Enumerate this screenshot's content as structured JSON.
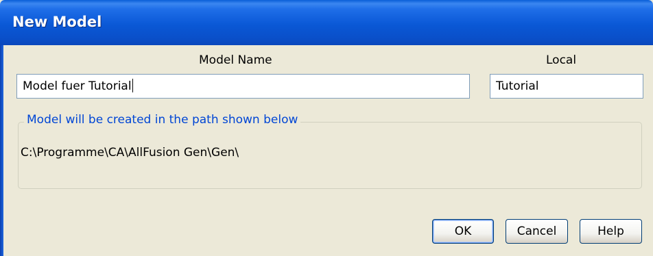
{
  "window": {
    "title": "New Model"
  },
  "form": {
    "model_name_label": "Model Name",
    "model_name_value": "Model fuer Tutorial",
    "local_label": "Local",
    "local_value": "Tutorial"
  },
  "path_group": {
    "legend": "Model will be created in the path shown below",
    "path": "C:\\Programme\\CA\\AllFusion Gen\\Gen\\"
  },
  "buttons": {
    "ok": "OK",
    "cancel": "Cancel",
    "help": "Help"
  }
}
